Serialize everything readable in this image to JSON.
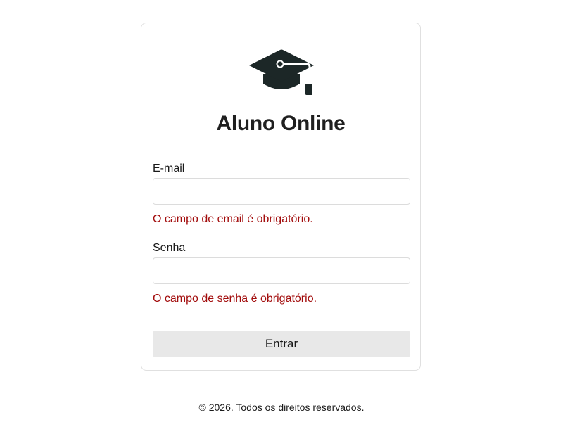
{
  "app": {
    "logo_icon": "graduation-cap-icon",
    "title": "Aluno Online"
  },
  "form": {
    "email": {
      "label": "E-mail",
      "value": "",
      "error": "O campo de email é obrigatório."
    },
    "password": {
      "label": "Senha",
      "value": "",
      "error": "O campo de senha é obrigatório."
    },
    "submit_label": "Entrar"
  },
  "footer": {
    "text": "© 2026. Todos os direitos reservados."
  },
  "colors": {
    "error": "#a20c0c",
    "button_bg": "#e8e8e8",
    "border": "#e0e0e0",
    "logo": "#1c2727"
  }
}
